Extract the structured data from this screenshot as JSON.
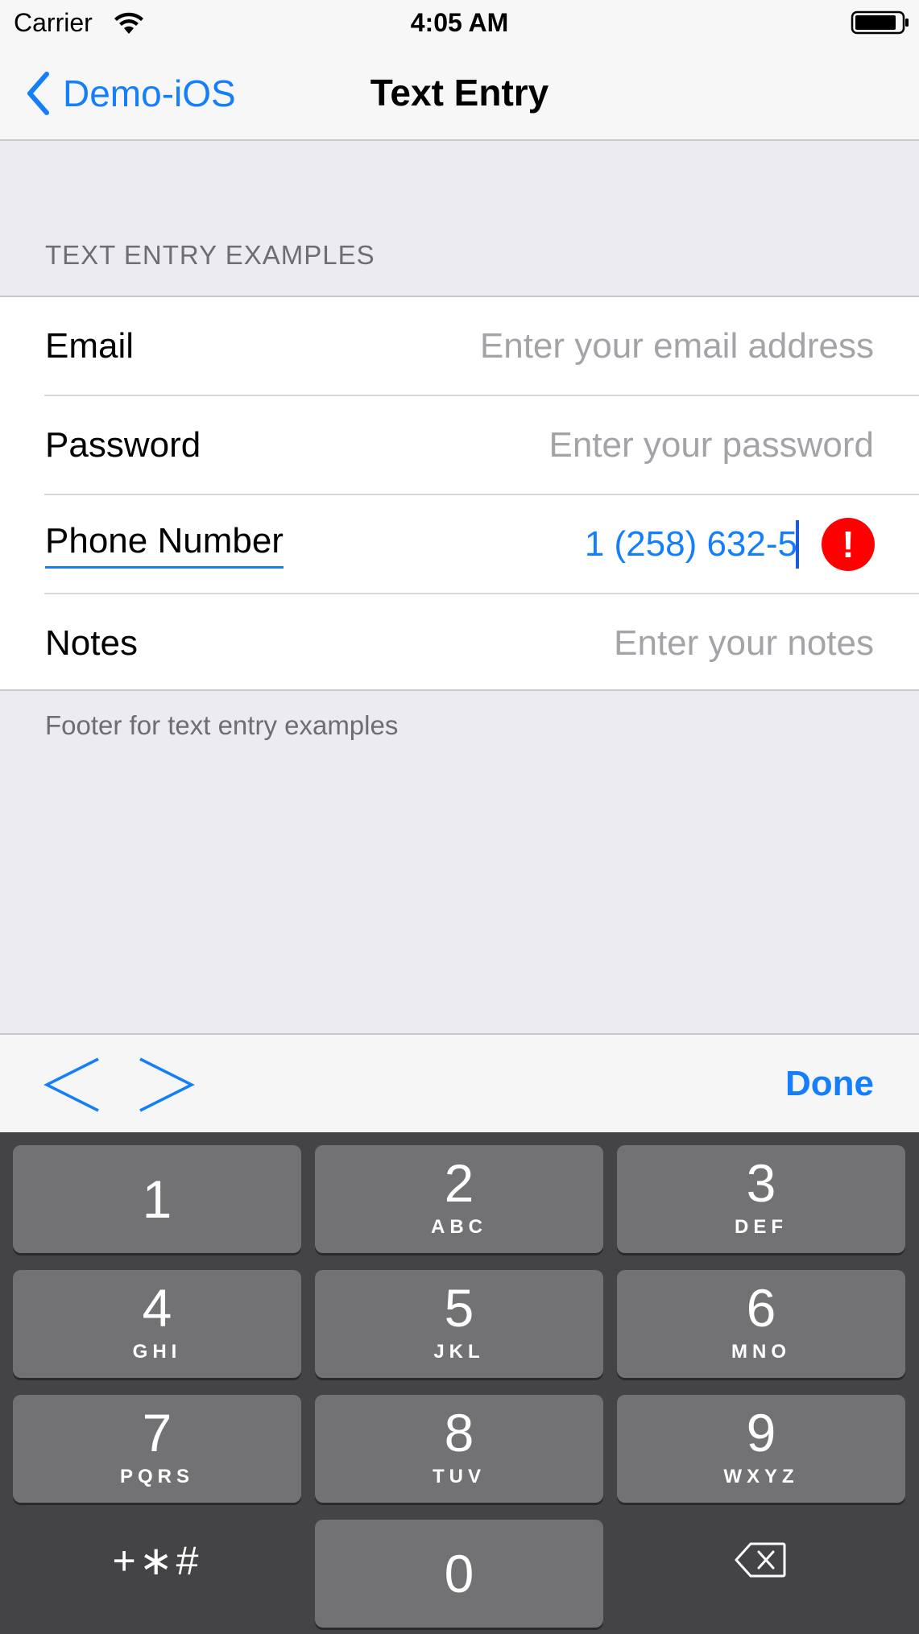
{
  "status_bar": {
    "carrier": "Carrier",
    "time": "4:05 AM"
  },
  "nav": {
    "back_label": "Demo-iOS",
    "title": "Text Entry"
  },
  "section": {
    "header": "TEXT ENTRY EXAMPLES",
    "footer": "Footer for text entry examples",
    "rows": [
      {
        "label": "Email",
        "placeholder": "Enter your email address"
      },
      {
        "label": "Password",
        "placeholder": "Enter your password"
      },
      {
        "label": "Phone Number",
        "value": "1 (258) 632-5"
      },
      {
        "label": "Notes",
        "placeholder": "Enter your notes"
      }
    ]
  },
  "error_indicator": "!",
  "accessory": {
    "done_label": "Done"
  },
  "keyboard": {
    "keys": [
      {
        "digit": "1",
        "letters": ""
      },
      {
        "digit": "2",
        "letters": "ABC"
      },
      {
        "digit": "3",
        "letters": "DEF"
      },
      {
        "digit": "4",
        "letters": "GHI"
      },
      {
        "digit": "5",
        "letters": "JKL"
      },
      {
        "digit": "6",
        "letters": "MNO"
      },
      {
        "digit": "7",
        "letters": "PQRS"
      },
      {
        "digit": "8",
        "letters": "TUV"
      },
      {
        "digit": "9",
        "letters": "WXYZ"
      },
      {
        "digit": "0",
        "letters": ""
      }
    ],
    "symbols_label": "+∗#",
    "delete_icon": "backspace-icon"
  },
  "colors": {
    "accent": "#147efb",
    "error": "#ff0000",
    "keyboard_bg": "#444446",
    "key_bg": "#727274"
  }
}
